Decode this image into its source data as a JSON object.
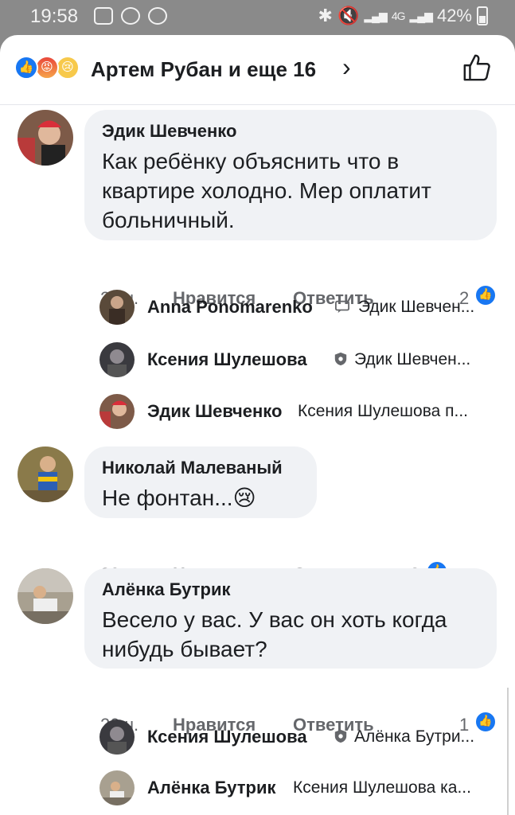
{
  "status_bar": {
    "time": "19:58",
    "signal_label": "4G",
    "battery": "42%"
  },
  "header": {
    "title": "Артем Рубан и еще 16",
    "reactions": [
      "like-icon",
      "angry-icon",
      "sad-icon"
    ]
  },
  "comments": [
    {
      "author": "Эдик Шевченко",
      "text_lines": [
        "Как ребёнку объяснить что в",
        "квартире холодно. Мер оплатит",
        "больничный."
      ],
      "time": "21 ч.",
      "like_label": "Нравится",
      "reply_label": "Ответить",
      "likes": "2"
    },
    {
      "author": "Николай Малеваный",
      "text_lines": [
        "Не фонтан...😢"
      ],
      "time": "20 ч.",
      "like_label": "Нравится",
      "reply_label": "Ответить",
      "likes": "2"
    },
    {
      "author": "Алёнка Бутрик",
      "text_lines": [
        "Весело у вас. У вас он хоть когда",
        "нибудь бывает?"
      ],
      "time": "20 ч.",
      "like_label": "Нравится",
      "reply_label": "Ответить",
      "likes": "1"
    }
  ],
  "replies": [
    {
      "author": "Anna Ponomarenko",
      "meta": "Эдик Шевчен..."
    },
    {
      "author": "Ксения Шулешова",
      "meta": "Эдик Шевчен..."
    },
    {
      "author": "Эдик Шевченко",
      "meta": "Ксения Шулешова п..."
    },
    {
      "author": "Ксения Шулешова",
      "meta": "Алёнка Бутри..."
    },
    {
      "author": "Алёнка Бутрик",
      "meta": "Ксения Шулешова ка..."
    }
  ]
}
